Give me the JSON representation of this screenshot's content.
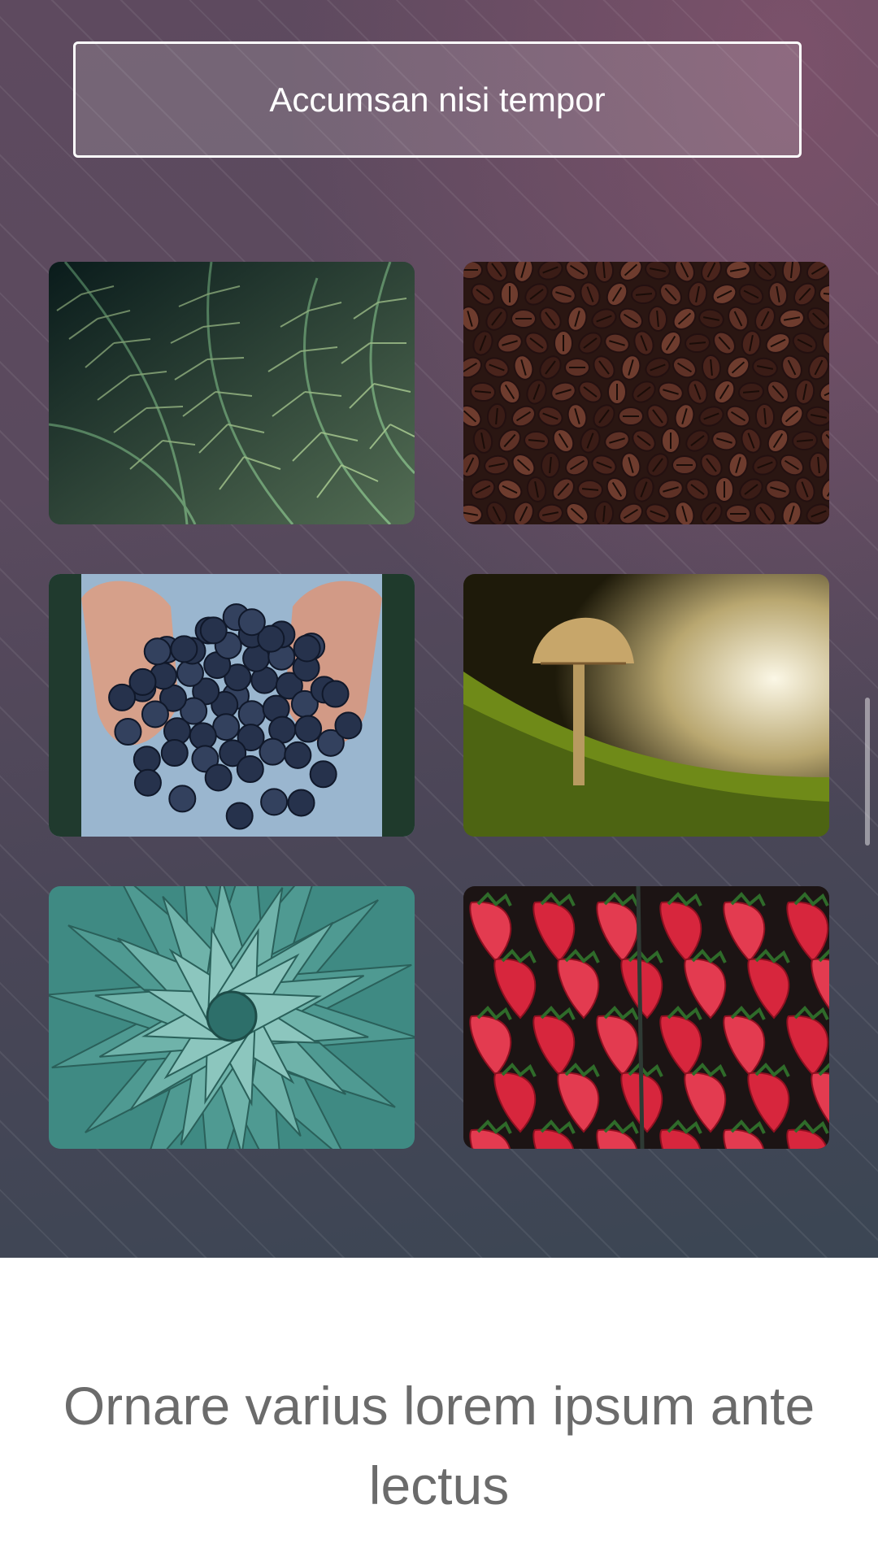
{
  "hero": {
    "button_label": "Accumsan nisi tempor"
  },
  "gallery": {
    "tiles": [
      {
        "subject": "fern-leaves",
        "palette": [
          "#0f2a2a",
          "#4f8f6a",
          "#b9d99a"
        ]
      },
      {
        "subject": "coffee-beans",
        "palette": [
          "#2a1612",
          "#5a2e24",
          "#8a5a48"
        ]
      },
      {
        "subject": "grapes-in-hands",
        "palette": [
          "#9ab6cf",
          "#1e2a40",
          "#d9a38f"
        ]
      },
      {
        "subject": "mushroom-on-moss",
        "palette": [
          "#1c1a08",
          "#7f8f1e",
          "#efe6c8"
        ]
      },
      {
        "subject": "agave-plant",
        "palette": [
          "#2d6f6a",
          "#5fa8a0",
          "#b7ddd6"
        ]
      },
      {
        "subject": "strawberries",
        "palette": [
          "#1c1414",
          "#d7263d",
          "#f06a74"
        ]
      }
    ]
  },
  "footer": {
    "heading": "Ornare varius lorem ipsum ante lectus"
  }
}
